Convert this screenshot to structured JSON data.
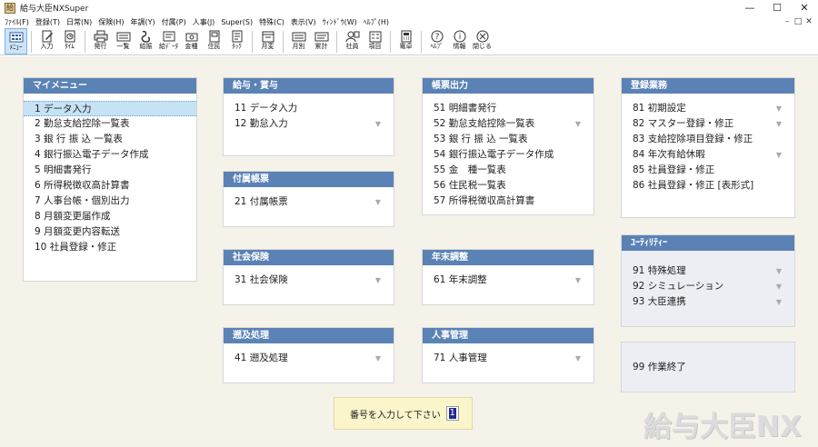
{
  "window": {
    "title": "給与大臣NXSuper",
    "app_icon_text": "給",
    "minimize": "—",
    "maximize": "☐",
    "close": "✕"
  },
  "menubar": {
    "items": [
      "ﾌｧｲﾙ(F)",
      "登録(T)",
      "日常(N)",
      "保険(H)",
      "年調(Y)",
      "付属(P)",
      "人事(J)",
      "Super(S)",
      "特殊(C)",
      "表示(V)",
      "ｳｨﾝﾄﾞｳ(W)",
      "ﾍﾙﾌﾟ(H)"
    ],
    "mdi_buttons": [
      "–",
      "□",
      "✕"
    ]
  },
  "toolbar": {
    "buttons": [
      {
        "label": "ﾒﾆｭｰ",
        "icon": "menu-grid-icon",
        "active": true
      },
      {
        "label": "入力",
        "icon": "input-pen-icon"
      },
      {
        "label": "ﾀｲﾑ",
        "icon": "time-sheet-icon"
      },
      {
        "label": "発行",
        "icon": "print-icon"
      },
      {
        "label": "一覧",
        "icon": "keyboard-list-icon"
      },
      {
        "label": "給振",
        "icon": "bank-transfer-icon"
      },
      {
        "label": "給ﾃﾞｰﾀ",
        "icon": "pay-data-icon"
      },
      {
        "label": "金種",
        "icon": "money-type-icon"
      },
      {
        "label": "住民",
        "icon": "resident-icon"
      },
      {
        "label": "ﾀｯｸ",
        "icon": "tax-icon"
      },
      {
        "label": "月変",
        "icon": "monthly-change-icon"
      },
      {
        "label": "月別",
        "icon": "monthly-icon"
      },
      {
        "label": "累計",
        "icon": "cumulative-icon"
      },
      {
        "label": "社員",
        "icon": "employee-icon"
      },
      {
        "label": "項目",
        "icon": "items-icon"
      },
      {
        "label": "電卓",
        "icon": "calculator-icon"
      },
      {
        "label": "ﾍﾙﾌﾟ",
        "icon": "help-icon"
      },
      {
        "label": "情報",
        "icon": "info-icon"
      },
      {
        "label": "閉じる",
        "icon": "close-circle-icon"
      }
    ]
  },
  "panels": {
    "mymenu": {
      "title": "マイメニュー",
      "items": [
        {
          "label": "1 データ入力",
          "selected": true
        },
        {
          "label": "2 勤怠支給控除一覧表"
        },
        {
          "label": "3 銀 行 振 込 一覧表"
        },
        {
          "label": "4 銀行振込電子データ作成"
        },
        {
          "label": "5 明細書発行"
        },
        {
          "label": "6 所得税徴収高計算書"
        },
        {
          "label": "7 人事台帳・個別出力"
        },
        {
          "label": "8 月額変更届作成"
        },
        {
          "label": "9 月額変更内容転送"
        },
        {
          "label": "10 社員登録・修正"
        }
      ]
    },
    "kyuyo": {
      "title": "給与・賞与",
      "items": [
        {
          "label": "11 データ入力"
        },
        {
          "label": "12 勤怠入力",
          "arrow": true
        }
      ]
    },
    "fuzoku": {
      "title": "付属帳票",
      "items": [
        {
          "label": "21 付属帳票",
          "arrow": true
        }
      ]
    },
    "shakai": {
      "title": "社会保険",
      "items": [
        {
          "label": "31 社会保険",
          "arrow": true
        }
      ]
    },
    "sokyu": {
      "title": "遡及処理",
      "items": [
        {
          "label": "41 遡及処理",
          "arrow": true
        }
      ]
    },
    "chohyo": {
      "title": "帳票出力",
      "items": [
        {
          "label": "51 明細書発行"
        },
        {
          "label": "52 勤怠支給控除一覧表",
          "arrow": true
        },
        {
          "label": "53 銀 行 振 込 一覧表"
        },
        {
          "label": "54 銀行振込電子データ作成"
        },
        {
          "label": "55 金　種一覧表"
        },
        {
          "label": "56 住民税一覧表"
        },
        {
          "label": "57 所得税徴収高計算書"
        }
      ]
    },
    "nenmatsu": {
      "title": "年末調整",
      "items": [
        {
          "label": "61 年末調整",
          "arrow": true
        }
      ]
    },
    "jinji": {
      "title": "人事管理",
      "items": [
        {
          "label": "71 人事管理",
          "arrow": true
        }
      ]
    },
    "toroku": {
      "title": "登録業務",
      "items": [
        {
          "label": "81 初期設定",
          "arrow": true
        },
        {
          "label": "82 マスター登録・修正",
          "arrow": true
        },
        {
          "label": "83 支給控除項目登録・修正"
        },
        {
          "label": "84 年次有給休暇",
          "arrow": true
        },
        {
          "label": "85 社員登録・修正"
        },
        {
          "label": "86 社員登録・修正 [表形式]"
        }
      ]
    },
    "utility": {
      "title": "ﾕｰﾃｨﾘﾃｨｰ",
      "items": [
        {
          "label": "91 特殊処理",
          "arrow": true
        },
        {
          "label": "92 シミュレーション",
          "arrow": true
        },
        {
          "label": "93 大臣連携",
          "arrow": true
        }
      ]
    },
    "exit": {
      "items": [
        {
          "label": "99 作業終了"
        }
      ]
    }
  },
  "input": {
    "label": "番号を入力して下さい",
    "value": "1"
  },
  "logo": {
    "text": "給与大臣NX"
  },
  "arrow_glyph": "▼"
}
